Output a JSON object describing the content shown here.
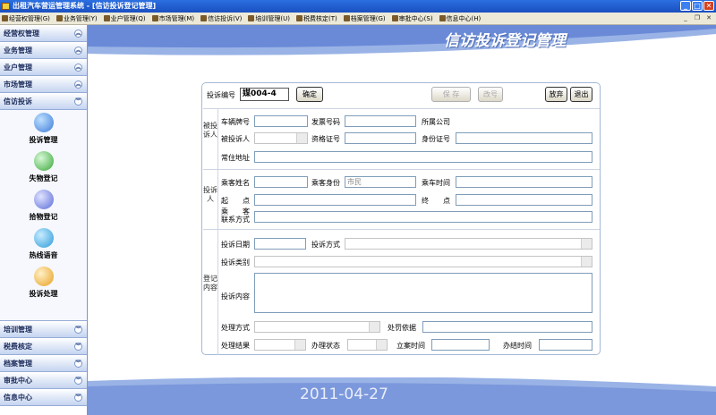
{
  "window": {
    "title": "出租汽车营运管理系统 - [信访投诉登记管理]"
  },
  "menu": [
    {
      "label": "经营权管理(G)"
    },
    {
      "label": "业务管理(Y)"
    },
    {
      "label": "业户管理(Q)"
    },
    {
      "label": "市场管理(M)"
    },
    {
      "label": "信访投诉(V)"
    },
    {
      "label": "培训管理(U)"
    },
    {
      "label": "税费核定(T)"
    },
    {
      "label": "档案管理(G)"
    },
    {
      "label": "审批中心(S)"
    },
    {
      "label": "信息中心(H)"
    }
  ],
  "sidebar": {
    "sections_top": [
      "经营权管理",
      "业务管理",
      "业户管理",
      "市场管理"
    ],
    "active_section": "信访投诉",
    "items": [
      {
        "label": "投诉管理",
        "icon": "complaint-icon",
        "color": "#3a7ad8"
      },
      {
        "label": "失物登记",
        "icon": "lost-item-icon",
        "color": "#38a838"
      },
      {
        "label": "拾物登记",
        "icon": "found-item-icon",
        "color": "#5a6ad8"
      },
      {
        "label": "热线语音",
        "icon": "hotline-icon",
        "color": "#2a9ad8"
      },
      {
        "label": "投诉处理",
        "icon": "handling-icon",
        "color": "#e8a020"
      }
    ],
    "sections_bottom": [
      "培训管理",
      "税费核定",
      "档案管理",
      "审批中心",
      "信息中心"
    ]
  },
  "page": {
    "heading": "信访投诉登记管理",
    "date": "2011-04-27"
  },
  "form": {
    "complaint_no_label": "投诉编号",
    "complaint_no_value": "媒004-4",
    "buttons": {
      "confirm": "确定",
      "save": "保 存",
      "change_no": "改号",
      "cancel": "放弃",
      "exit": "退出"
    },
    "section1": {
      "title": "被投诉人",
      "plate_label": "车辆牌号",
      "invoice_label": "发票号码",
      "company_label": "所属公司",
      "person_label": "被投诉人",
      "cert_label": "资格证号",
      "id_label": "身份证号",
      "address_label": "常住地址"
    },
    "section2": {
      "title": "投诉人",
      "name_label": "乘客姓名",
      "identity_label": "乘客身份",
      "identity_value": "市民",
      "ride_time_label": "乘车时间",
      "start_label": "起　　点",
      "end_label": "终　　点",
      "contact_label_1": "乘　　客",
      "contact_label_2": "联系方式"
    },
    "section3": {
      "title": "登记内容",
      "date_label": "投诉日期",
      "method_label": "投诉方式",
      "category_label": "投诉类别",
      "content_label": "投诉内容",
      "handling_label": "处理方式",
      "penalty_label": "处罚依据",
      "result_label": "处理结果",
      "status_label": "办理状态",
      "filed_label": "立案时间",
      "closed_label": "办结时间"
    }
  },
  "colors": {
    "titlebar": "#1a4fc0",
    "banner": "#6a8ad8",
    "footer": "#8aa6de",
    "accent": "#3a6ad0"
  }
}
